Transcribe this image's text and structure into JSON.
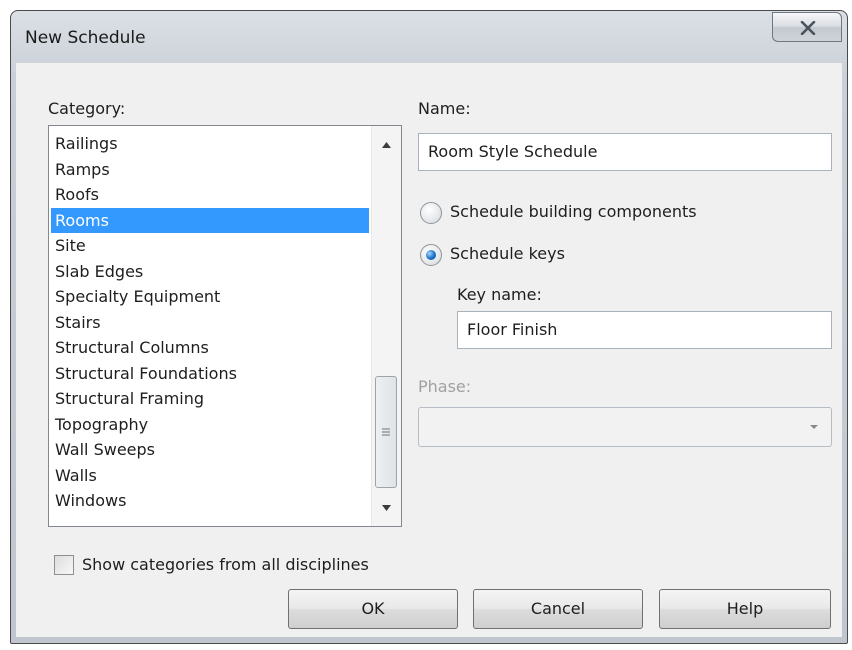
{
  "window": {
    "title": "New Schedule"
  },
  "category": {
    "label": "Category:",
    "items": [
      {
        "label": "Railings"
      },
      {
        "label": "Ramps"
      },
      {
        "label": "Roofs"
      },
      {
        "label": "Rooms",
        "selected": true
      },
      {
        "label": "Site"
      },
      {
        "label": "Slab Edges"
      },
      {
        "label": "Specialty Equipment"
      },
      {
        "label": "Stairs"
      },
      {
        "label": "Structural Columns"
      },
      {
        "label": "Structural Foundations"
      },
      {
        "label": "Structural Framing"
      },
      {
        "label": "Topography"
      },
      {
        "label": "Wall Sweeps"
      },
      {
        "label": "Walls"
      },
      {
        "label": "Windows"
      }
    ],
    "show_all_label": "Show categories from all disciplines",
    "show_all_checked": false
  },
  "name": {
    "label": "Name:",
    "value": "Room Style Schedule"
  },
  "options": {
    "building_components_label": "Schedule building components",
    "schedule_keys_label": "Schedule keys",
    "selected": "schedule_keys"
  },
  "key_name": {
    "label": "Key name:",
    "value": "Floor Finish"
  },
  "phase": {
    "label": "Phase:",
    "value": "",
    "disabled": true
  },
  "buttons": {
    "ok": "OK",
    "cancel": "Cancel",
    "help": "Help"
  },
  "colors": {
    "selection": "#3399ff",
    "radio_selected": "#1a6fc4",
    "client_bg": "#f0f0f0",
    "disabled_text": "#a0a0a0"
  }
}
